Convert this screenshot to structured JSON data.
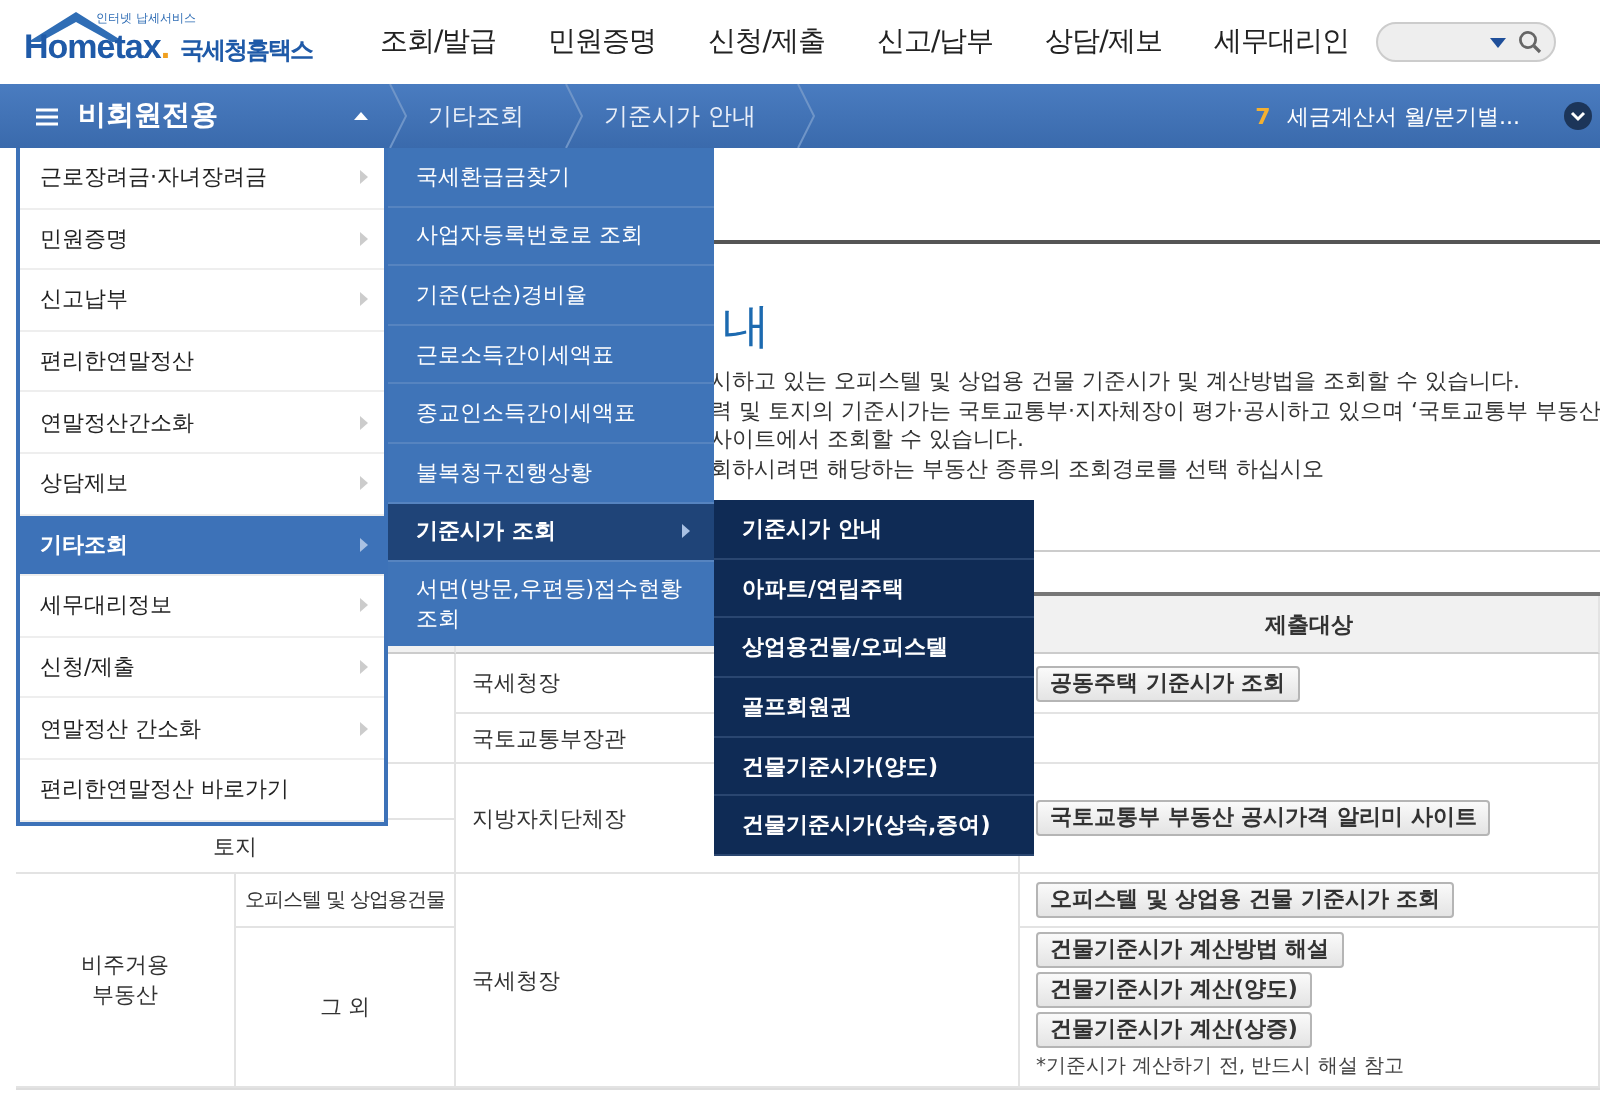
{
  "header": {
    "logo_tagline": "인터넷 납세서비스",
    "logo_text": "Hometax",
    "logo_suffix": ".",
    "logo_name": "국세청홈택스",
    "nav": [
      "조회/발급",
      "민원증명",
      "신청/제출",
      "신고/납부",
      "상담/제보",
      "세무대리인"
    ]
  },
  "bar": {
    "menu_label": "비회원전용",
    "menu_expanded": true,
    "breadcrumbs": [
      "기타조회",
      "기준시가 안내"
    ],
    "notice_number": "7",
    "notice_text": "세금계산서 월/분기별..."
  },
  "menu": [
    {
      "label": "근로장려금·자녀장려금",
      "selected": false,
      "has_submenu": true
    },
    {
      "label": "민원증명",
      "selected": false,
      "has_submenu": true
    },
    {
      "label": "신고납부",
      "selected": false,
      "has_submenu": true
    },
    {
      "label": "편리한연말정산",
      "selected": false,
      "has_submenu": false
    },
    {
      "label": "연말정산간소화",
      "selected": false,
      "has_submenu": true
    },
    {
      "label": "상담제보",
      "selected": false,
      "has_submenu": true
    },
    {
      "label": "기타조회",
      "selected": true,
      "has_submenu": true
    },
    {
      "label": "세무대리정보",
      "selected": false,
      "has_submenu": true
    },
    {
      "label": "신청/제출",
      "selected": false,
      "has_submenu": true
    },
    {
      "label": "연말정산 간소화",
      "selected": false,
      "has_submenu": true
    },
    {
      "label": "편리한연말정산 바로가기",
      "selected": false,
      "has_submenu": false
    }
  ],
  "submenu": [
    {
      "label": "국세환급금찾기",
      "selected": false,
      "has_submenu": false
    },
    {
      "label": "사업자등록번호로 조회",
      "selected": false,
      "has_submenu": false
    },
    {
      "label": "기준(단순)경비율",
      "selected": false,
      "has_submenu": false
    },
    {
      "label": "근로소득간이세액표",
      "selected": false,
      "has_submenu": false
    },
    {
      "label": "종교인소득간이세액표",
      "selected": false,
      "has_submenu": false
    },
    {
      "label": "불복청구진행상황",
      "selected": false,
      "has_submenu": false
    },
    {
      "label": "기준시가 조회",
      "selected": true,
      "has_submenu": true
    },
    {
      "label": "서면(방문,우편등)접수현황 조회",
      "selected": false,
      "has_submenu": false
    }
  ],
  "submenu2": [
    {
      "label": "기준시가 안내",
      "selected": false
    },
    {
      "label": "아파트/연립주택",
      "selected": false
    },
    {
      "label": "상업용건물/오피스텔",
      "selected": false
    },
    {
      "label": "골프회원권",
      "selected": false
    },
    {
      "label": "건물기준시가(양도)",
      "selected": false
    },
    {
      "label": "건물기준시가(상속,증여)",
      "selected": false
    }
  ],
  "page": {
    "title": "내",
    "intro": [
      "시하고 있는 오피스텔 및 상업용 건물 기준시가 및 계산방법을 조회할 수 있습니다.",
      "력 및 토지의 기준시가는 국토교통부·지자체장이 평가·공시하고 있으며 ‘국토교통부 부동산",
      "사이트에서 조회할 수 있습니다.",
      "회하시려면 해당하는 부동산 종류의 조회경로를 선택 하십시오"
    ]
  },
  "table": {
    "header_col4": "제출대상",
    "r1_col3": "국세청장",
    "r1_button": "공동주택 기준시가 조회",
    "r2_col3": "국토교통부장관",
    "r3_col3": "지방자치단체장",
    "r3_button": "국토교통부 부동산 공시가격 알리미 사이트",
    "r4_col1": "토지",
    "r5_col1": "비주거용\n부동산",
    "r5_col2": "오피스텔 및 상업용건물",
    "r5_col3": "국세청장",
    "r5_button": "오피스텔 및 상업용 건물 기준시가 조회",
    "r6_col2": "그 외",
    "r6_buttons": [
      "건물기준시가 계산방법 해설",
      "건물기준시가 계산(양도)",
      "건물기준시가 계산(상증)"
    ],
    "r6_note": "*기준시가 계산하기 전, 반드시 해설 참고"
  }
}
